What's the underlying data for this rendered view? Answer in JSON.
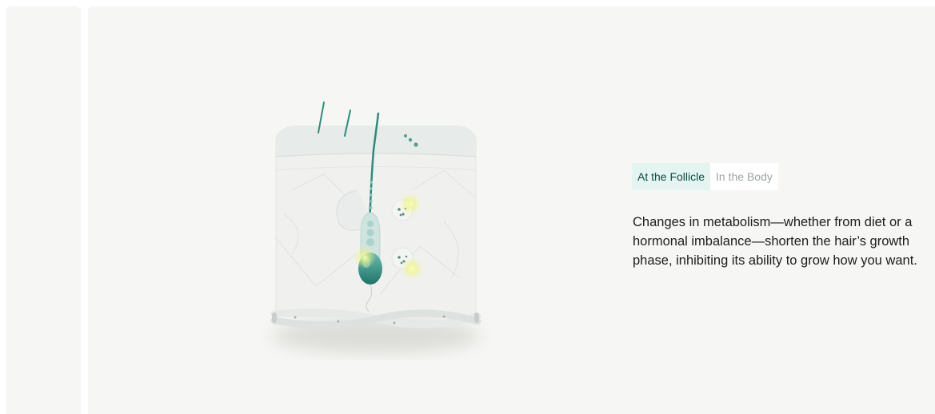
{
  "tabs": [
    {
      "label": "At the Follicle",
      "active": true
    },
    {
      "label": "In the Body",
      "active": false
    }
  ],
  "description": "Changes in metabolism—whether from diet or a hormonal imbalance—shorten the hair’s growth phase, inhibiting its ability to grow how you want.",
  "colors": {
    "panel_bg": "#f6f6f4",
    "active_tab_bg": "#e3f4f1",
    "active_tab_text": "#0d4b45",
    "inactive_tab_text": "#9ea5a3",
    "follicle_green": "#2a8d7e",
    "highlight_yellow": "#f2f27a"
  },
  "illustration": {
    "icon": "hair-follicle-illustration"
  }
}
